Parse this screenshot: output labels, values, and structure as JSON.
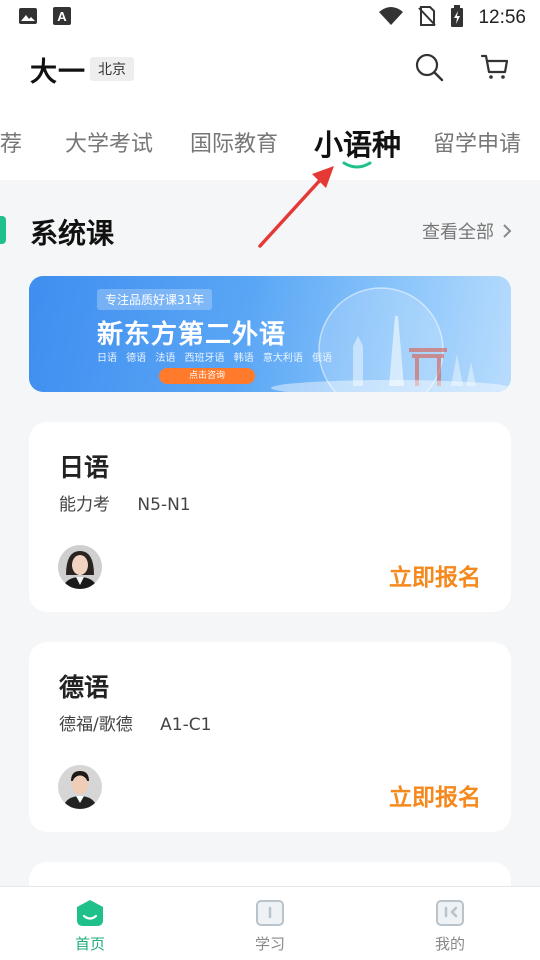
{
  "status": {
    "time": "12:56"
  },
  "header": {
    "grade": "大一",
    "city": "北京"
  },
  "tabs": [
    {
      "label": "推荐",
      "active": false
    },
    {
      "label": "大学考试",
      "active": false
    },
    {
      "label": "国际教育",
      "active": false
    },
    {
      "label": "小语种",
      "active": true
    },
    {
      "label": "留学申请",
      "active": false
    }
  ],
  "section": {
    "title": "系统课",
    "see_all": "查看全部"
  },
  "banner": {
    "tag": "专注品质好课31年",
    "title": "新东方第二外语",
    "languages": "日语 德语 法语 西班牙语 韩语 意大利语 俄语",
    "button": "点击咨询"
  },
  "courses": [
    {
      "title": "日语",
      "subtitle": "能力考",
      "level": "N5-N1",
      "action": "立即报名"
    },
    {
      "title": "德语",
      "subtitle": "德福/歌德",
      "level": "A1-C1",
      "action": "立即报名"
    }
  ],
  "bottom_nav": [
    {
      "label": "首页",
      "active": true
    },
    {
      "label": "学习",
      "active": false
    },
    {
      "label": "我的",
      "active": false
    }
  ],
  "colors": {
    "accent": "#1fc08a",
    "enroll": "#f5891e",
    "arrow": "#e53935"
  }
}
